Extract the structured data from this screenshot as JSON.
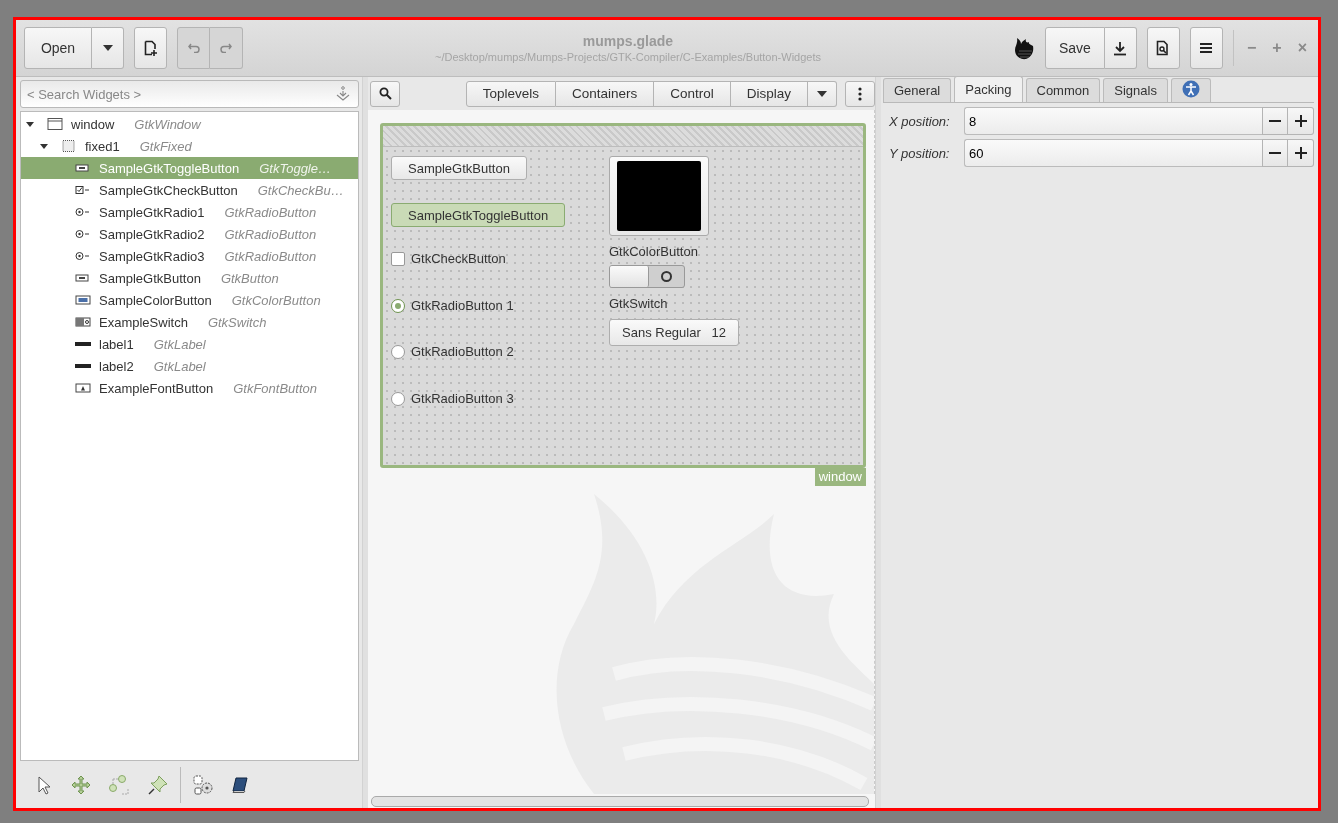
{
  "window": {
    "title": "mumps.glade",
    "subtitle": "~/Desktop/mumps/Mumps-Projects/GTK-Compiler/C-Examples/Button-Widgets",
    "controls": [
      "−",
      "+",
      "×"
    ]
  },
  "header": {
    "open_label": "Open",
    "save_label": "Save"
  },
  "search": {
    "placeholder": "< Search Widgets >"
  },
  "tree": [
    {
      "name": "window",
      "type": "GtkWindow",
      "kind": "window",
      "expanded": true,
      "selected": false,
      "children": [
        {
          "name": "fixed1",
          "type": "GtkFixed",
          "kind": "fixed",
          "expanded": true,
          "selected": false,
          "children": [
            {
              "name": "SampleGtkToggleButton",
              "type": "GtkToggle…",
              "kind": "toggle",
              "selected": true
            },
            {
              "name": "SampleGtkCheckButton",
              "type": "GtkCheckBu…",
              "kind": "check",
              "selected": false
            },
            {
              "name": "SampleGtkRadio1",
              "type": "GtkRadioButton",
              "kind": "radio",
              "selected": false
            },
            {
              "name": "SampleGtkRadio2",
              "type": "GtkRadioButton",
              "kind": "radio",
              "selected": false
            },
            {
              "name": "SampleGtkRadio3",
              "type": "GtkRadioButton",
              "kind": "radio",
              "selected": false
            },
            {
              "name": "SampleGtkButton",
              "type": "GtkButton",
              "kind": "button",
              "selected": false
            },
            {
              "name": "SampleColorButton",
              "type": "GtkColorButton",
              "kind": "color",
              "selected": false
            },
            {
              "name": "ExampleSwitch",
              "type": "GtkSwitch",
              "kind": "switch",
              "selected": false
            },
            {
              "name": "label1",
              "type": "GtkLabel",
              "kind": "label",
              "selected": false
            },
            {
              "name": "label2",
              "type": "GtkLabel",
              "kind": "label",
              "selected": false
            },
            {
              "name": "ExampleFontButton",
              "type": "GtkFontButton",
              "kind": "font",
              "selected": false
            }
          ]
        }
      ]
    }
  ],
  "palette": {
    "groups": [
      "Toplevels",
      "Containers",
      "Control",
      "Display"
    ]
  },
  "canvas": {
    "window_tag": "window",
    "left": [
      {
        "kind": "button",
        "label": "SampleGtkButton"
      },
      {
        "kind": "toggle",
        "label": "SampleGtkToggleButton",
        "active": true
      },
      {
        "kind": "check",
        "label": "GtkCheckButton",
        "checked": false
      },
      {
        "kind": "radio",
        "label": "GtkRadioButton 1",
        "selected": true
      },
      {
        "kind": "radio",
        "label": "GtkRadioButton 2",
        "selected": false
      },
      {
        "kind": "radio",
        "label": "GtkRadioButton 3",
        "selected": false
      }
    ],
    "right": [
      {
        "kind": "color",
        "color": "#000000"
      },
      {
        "kind": "label",
        "label": "GtkColorButton"
      },
      {
        "kind": "switch",
        "on": false
      },
      {
        "kind": "label",
        "label": "GtkSwitch"
      },
      {
        "kind": "font",
        "label": "Sans Regular",
        "size": "12"
      }
    ]
  },
  "properties": {
    "tabs": [
      {
        "kind": "text",
        "label": "General",
        "selected": false
      },
      {
        "kind": "text",
        "label": "Packing",
        "selected": true
      },
      {
        "kind": "text",
        "label": "Common",
        "selected": false
      },
      {
        "kind": "text",
        "label": "Signals",
        "selected": false
      },
      {
        "kind": "accessibility",
        "selected": false
      }
    ],
    "fields": [
      {
        "label": "X position:",
        "value": "8"
      },
      {
        "label": "Y position:",
        "value": "60"
      }
    ]
  }
}
